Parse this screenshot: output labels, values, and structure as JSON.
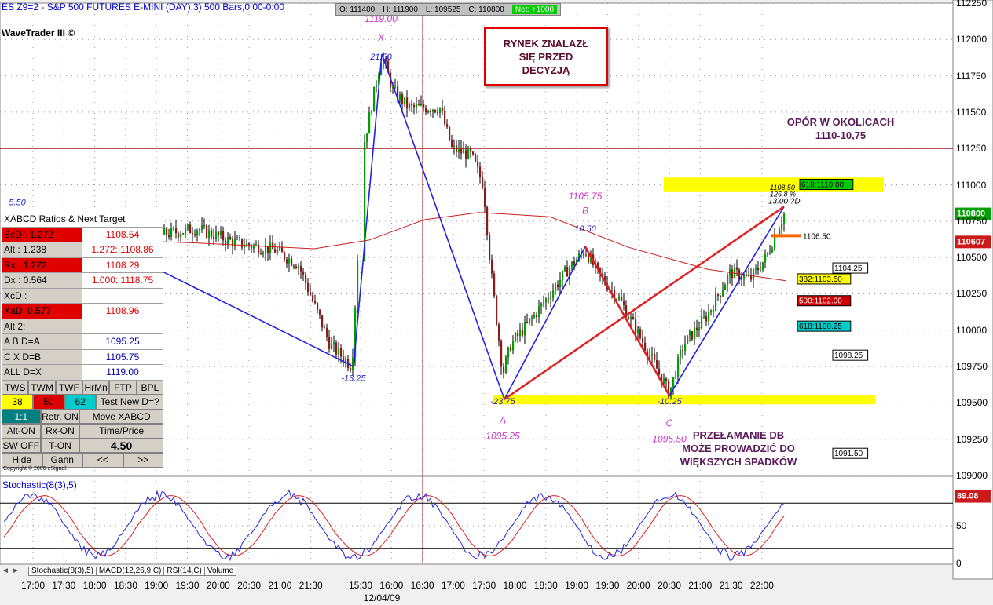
{
  "header": {
    "title": "ES Z9=2 - S&P 500 FUTURES E-MINI (DAY),3) 500 Bars,0:00-0:00",
    "brand": "WaveTrader III ©",
    "ohlc": {
      "open": "O: 111400",
      "high": "H: 111900",
      "low": "L: 109525",
      "close": "C: 110800",
      "net": "Net: +1000"
    }
  },
  "notes": {
    "box": [
      "RYNEK ZNALAZŁ",
      "SIĘ PRZED",
      "DECYZJĄ"
    ],
    "resistance": [
      "OPÓR W OKOLICACH",
      "1110-10,75"
    ],
    "breakout": [
      "PRZEŁAMANIE DB",
      "MOŻE PROWADZIĆ DO",
      "WIĘKSZYCH SPADKÓW"
    ]
  },
  "panel": {
    "header": "XABCD Ratios & Next Target",
    "rows": [
      {
        "label": "BcD :   1.272",
        "value": "1108.54",
        "red": true
      },
      {
        "label": "Alt  :   1.238",
        "value": "1.272: 1108.86",
        "red": false
      },
      {
        "label": "Rx  :   1.272",
        "value": "1108.29",
        "red": true
      },
      {
        "label": "Dx  :   0.564",
        "value": "1.000: 1118.75",
        "red": false
      },
      {
        "label": "XcD :",
        "value": "",
        "red": false
      },
      {
        "label": "XaD:   0.577",
        "value": "1108.96",
        "red": true
      },
      {
        "label": "Alt 2:",
        "value": "",
        "red": false
      },
      {
        "label": "A  B  D=A",
        "value": "1095.25",
        "red": false
      },
      {
        "label": "C  X  D=B",
        "value": "1105.75",
        "red": false
      },
      {
        "label": "ALL   D=X",
        "value": "1119.00",
        "red": false
      }
    ],
    "buttons": [
      [
        "TWS",
        "TWM",
        "TWF",
        "HrMn",
        "FTP",
        "BPL"
      ],
      [
        "38",
        "50",
        "62",
        "Test New D=?"
      ],
      [
        "1:1",
        "Retr. ON",
        "Move XABCD"
      ],
      [
        "Alt-ON",
        "Rx-ON",
        "Time/Price"
      ],
      [
        "SW OFF",
        "T-ON",
        "4.50"
      ],
      [
        "Hide",
        "Gann",
        "<<",
        ">>"
      ]
    ],
    "copyright": "Copyright © 2006 eSignal."
  },
  "indicator": {
    "title": "Stochastic(8(3),5)",
    "value": "89.08",
    "tabs": [
      "Stochastic(8(3),5)",
      "MACD(12,26,9,C)",
      "RSI(14,C)",
      "Volume"
    ],
    "nav": "◄ ►"
  },
  "axis": {
    "price_ticks": [
      "112250",
      "112000",
      "111750",
      "111500",
      "111250",
      "111000",
      "110750",
      "110500",
      "110250",
      "110000",
      "109750",
      "109500",
      "109250",
      "109000"
    ],
    "stoch_ticks": [
      "50",
      "0"
    ],
    "time_ticks": [
      "17:00",
      "17:30",
      "18:00",
      "18:30",
      "19:00",
      "19:30",
      "20:00",
      "20:30",
      "21:00",
      "21:30",
      "15:30",
      "16:00",
      "16:30",
      "17:00",
      "17:30",
      "18:00",
      "18:30",
      "19:00",
      "19:30",
      "20:00",
      "20:30",
      "21:00",
      "21:30",
      "22:00"
    ],
    "date": "12/04/09",
    "last_price": "110800",
    "ma_price": "110607"
  },
  "chart_data": {
    "type": "candlestick",
    "pattern_points": [
      {
        "label": "X",
        "price": 1119.0,
        "ratio_label": "1119.00",
        "swing": "21.50"
      },
      {
        "label": "A",
        "price": 1095.25,
        "ratio_label": "1095.25",
        "swing": "-23.75"
      },
      {
        "label": "B",
        "price": 1105.75,
        "ratio_label": "1105.75",
        "swing": "10.50"
      },
      {
        "label": "C",
        "price": 1095.5,
        "ratio_label": "1095.50",
        "swing": "-10.25"
      },
      {
        "label": "D",
        "price": 1108.5,
        "ratio_label": "1108.50",
        "swing": "13.00 ?D"
      }
    ],
    "swing_labels": [
      "5.50",
      "-13.25"
    ],
    "d_ratio": "126.8 %",
    "targets": [
      {
        "text": "618:1110.00",
        "price": 1110.0,
        "color": "#00cc00"
      },
      {
        "text": "1106.50",
        "price": 1106.5,
        "color": "#ffffff"
      },
      {
        "text": "1104.25",
        "price": 1104.25,
        "color": "#ffffff"
      },
      {
        "text": "382:1103.50",
        "price": 1103.5,
        "color": "#ffff00"
      },
      {
        "text": "500:1102.00",
        "price": 1102.0,
        "color": "#cc0000"
      },
      {
        "text": "618:1100.25",
        "price": 1100.25,
        "color": "#00cccc"
      },
      {
        "text": "1098.25",
        "price": 1098.25,
        "color": "#ffffff"
      },
      {
        "text": "1091.50",
        "price": 1091.5,
        "color": "#ffffff"
      }
    ],
    "ylim": [
      1090.0,
      1122.5
    ],
    "colors": {
      "up": "#00a000",
      "down": "#8b1a1a",
      "xabcd": "#2222dd",
      "pattern": "#e02020",
      "ma": "#cc2020",
      "zone": "#ffff00",
      "stoch_k": "#2222dd",
      "stoch_d": "#dd2222"
    }
  }
}
